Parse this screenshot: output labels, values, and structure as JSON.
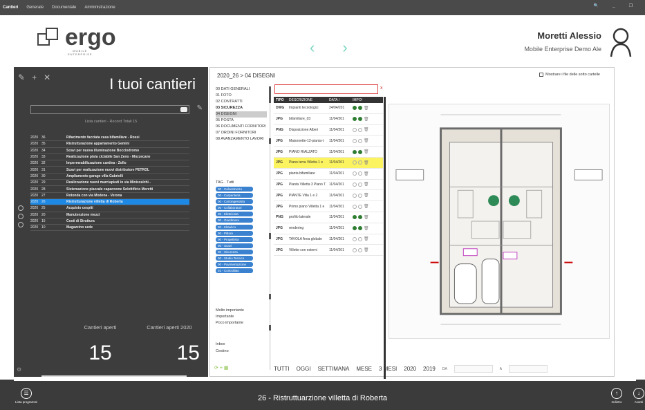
{
  "menubar": {
    "items": [
      "Cantieri",
      "Generale",
      "Documentale",
      "Amministrazione"
    ]
  },
  "window_controls": {
    "search": "🔍",
    "minimize": "_",
    "restore": "❐"
  },
  "header": {
    "logo_text": "ergo",
    "logo_sub1": "MOBILE",
    "logo_sub2": "ENTERPRISE",
    "nav_prev": "‹",
    "nav_next": "›",
    "user_name": "Moretti Alessio",
    "company": "Mobile Enterprise Demo Ale"
  },
  "left_panel": {
    "title": "I tuoi cantieri",
    "record_count": "Lista cantieri - Record Totali 15",
    "items": [
      {
        "year": "2020",
        "num": "36",
        "label": "Rifacimento facciata casa bifamiliare - Rossi"
      },
      {
        "year": "2020",
        "num": "35",
        "label": "Ristrutturazione appartamento Gemini"
      },
      {
        "year": "2020",
        "num": "34",
        "label": "Scavi per nuova illuminazione Bocciodromo"
      },
      {
        "year": "2020",
        "num": "33",
        "label": "Realizzazione pista ciclabile San Zeno - Mozzecane"
      },
      {
        "year": "2020",
        "num": "32",
        "label": "Impermeabilizzazione cantina - Zollo"
      },
      {
        "year": "2020",
        "num": "31",
        "label": "Scavi per realizzazione nuovi distributore PETROL"
      },
      {
        "year": "2020",
        "num": "30",
        "label": "Ampliamento garage villa Gabrielli"
      },
      {
        "year": "2020",
        "num": "29",
        "label": "Realizzazione nuovi marciapiedi in via Miniscalchi -"
      },
      {
        "year": "2020",
        "num": "28",
        "label": "Sistemazione piazzale capannone Solettificio Moretti"
      },
      {
        "year": "2020",
        "num": "27",
        "label": "Rotonda con via Modena - Verona"
      },
      {
        "year": "2020",
        "num": "26",
        "label": "Ristrutturazione villetta di Roberta"
      },
      {
        "year": "2020",
        "num": "25",
        "label": "Acquisto cespiti"
      },
      {
        "year": "2020",
        "num": "20",
        "label": "Manutenzione mezzi"
      },
      {
        "year": "2020",
        "num": "15",
        "label": "Costi di Struttura"
      },
      {
        "year": "2020",
        "num": "10",
        "label": "Magazzino sede"
      }
    ],
    "stat_open_label": "Cantieri aperti",
    "stat_open_value": "15",
    "stat_open2020_label": "Cantieri aperti 2020",
    "stat_open2020_value": "15"
  },
  "main": {
    "breadcrumb": "2020_26 > 04 DISEGNI",
    "subfolders_label": "Mostrare i file delle sotto cartelle",
    "folders": [
      "00 DATI GENERALI",
      "01 FOTO",
      "02 CONTRATTI",
      "03 SICUREZZA",
      "04 DISEGNI",
      "05 POSTA",
      "06 DOCUMENTI FORNITORI",
      "07 ORDINI FORNITORI",
      "08 AVANZAMENTO LAVORI"
    ],
    "tag_header_1": "TAG",
    "tag_header_2": "Tutti",
    "tags": [
      "00 - Calcestruzzo",
      "00 - Carpenteria",
      "00 - Cartongessista",
      "00 - Collaboratori",
      "00 - Elettricista",
      "00 - Giardiniere",
      "00 - Idraulico",
      "00 - Pittore",
      "00 - Progettista",
      "00 - Scavi",
      "00 - Sicurezza",
      "00 - Studio Tecnico",
      "00 - Pavimentazione",
      "01 - Controllato"
    ],
    "priorities": [
      "Molto importante",
      "Importante",
      "Poco importante"
    ],
    "boxes": [
      "Inbox",
      "Cestino"
    ],
    "file_search_close": "x",
    "table_headers": {
      "type": "TIPO",
      "desc": "DESCRIZIONE",
      "date": "DATA /",
      "impo": "IMPO!"
    },
    "files": [
      {
        "type": "DWG",
        "desc": "Impianti tecnologici",
        "date": "24/04/201",
        "on": true
      },
      {
        "type": "JPG",
        "desc": "bifamiliare_03",
        "date": "11/04/201",
        "on": true
      },
      {
        "type": "PNG",
        "desc": "Disposizione Alberi",
        "date": "11/04/201",
        "on": false
      },
      {
        "type": "JPG",
        "desc": "Maisonette-12-pianta-t",
        "date": "11/04/201",
        "on": false
      },
      {
        "type": "JPG",
        "desc": "PIANO RIALZATO",
        "date": "11/04/201",
        "on": true
      },
      {
        "type": "JPG",
        "desc": "Piano terra Villetta 1 e",
        "date": "11/04/201",
        "on": false
      },
      {
        "type": "JPG",
        "desc": "pianta bifamiliare",
        "date": "11/04/201",
        "on": false
      },
      {
        "type": "JPG",
        "desc": "Pianta Villetta 3 Piano T",
        "date": "11/04/201",
        "on": false
      },
      {
        "type": "JPG",
        "desc": "PIANTE Villa 1 e 2",
        "date": "11/04/201",
        "on": false
      },
      {
        "type": "JPG",
        "desc": "Primo piano Villetta 1 e",
        "date": "11/04/201",
        "on": false
      },
      {
        "type": "PNG",
        "desc": "profilo laterale",
        "date": "11/04/201",
        "on": true
      },
      {
        "type": "JPG",
        "desc": "rendering",
        "date": "11/04/201",
        "on": true
      },
      {
        "type": "JPG",
        "desc": "TAVOLA Area globale",
        "date": "11/04/201",
        "on": false
      },
      {
        "type": "JPG",
        "desc": "Villette con esterni",
        "date": "11/04/201",
        "on": false
      }
    ],
    "filters": [
      "TUTTI",
      "OGGI",
      "SETTIMANA",
      "MESE",
      "3 MESI",
      "2020",
      "2019"
    ],
    "date_from": "DA",
    "date_to": "A"
  },
  "bottom": {
    "title": "26 - Ristruttuarzione villetta di Roberta",
    "left_btn": "Lista programmi",
    "back_btn": "Indietro",
    "next_btn": "Avanti"
  }
}
